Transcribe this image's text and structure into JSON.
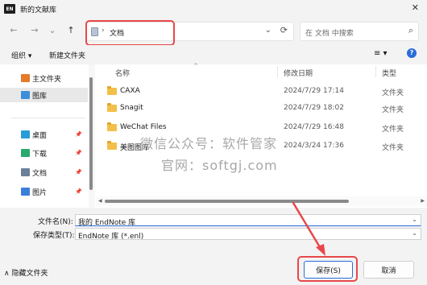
{
  "window": {
    "title": "新的文献库",
    "app_badge": "EN",
    "close_glyph": "✕"
  },
  "nav": {
    "back": "←",
    "forward": "→",
    "recent": "⌄",
    "up": "↑",
    "address_sep": "›",
    "address": "文档",
    "address_dropdown": "⌄",
    "refresh": "⟳",
    "search_placeholder": "在 文档 中搜索",
    "search_icon": "⌕"
  },
  "toolbar": {
    "organize": "组织 ▾",
    "new_folder": "新建文件夹",
    "view_glyph": "≡ ▾",
    "help_glyph": "?"
  },
  "sidebar": {
    "items": [
      {
        "label": "主文件夹",
        "icon": "home-icon",
        "color": "#e57a2a",
        "pinned": false
      },
      {
        "label": "图库",
        "icon": "gallery-icon",
        "color": "#3b8fd9",
        "pinned": false,
        "selected": true
      },
      {
        "label": "桌面",
        "icon": "desktop-icon",
        "color": "#2a9bd9",
        "pinned": true
      },
      {
        "label": "下载",
        "icon": "download-icon",
        "color": "#2aa86e",
        "pinned": true
      },
      {
        "label": "文档",
        "icon": "documents-icon",
        "color": "#6b7f99",
        "pinned": true
      },
      {
        "label": "图片",
        "icon": "pictures-icon",
        "color": "#3b7fd9",
        "pinned": true
      }
    ],
    "pin_glyph": "📌"
  },
  "filelist": {
    "columns": [
      "名称",
      "修改日期",
      "类型"
    ],
    "sort_caret": "^",
    "rows": [
      {
        "name": "CAXA",
        "date": "2024/7/29 17:14",
        "type": "文件夹"
      },
      {
        "name": "Snagit",
        "date": "2024/7/29 18:02",
        "type": "文件夹"
      },
      {
        "name": "WeChat Files",
        "date": "2024/7/29 16:48",
        "type": "文件夹"
      },
      {
        "name": "美图图库",
        "date": "2024/3/24 17:36",
        "type": "文件夹"
      }
    ],
    "scroll_left": "◀",
    "scroll_right": "▶"
  },
  "watermark": {
    "line1": "微信公众号：软件管家",
    "line2": "官网：softgj.com"
  },
  "bottom": {
    "filename_label": "文件名(N):",
    "filename_value": "我的 EndNote 库",
    "filetype_label": "保存类型(T):",
    "filetype_value": "EndNote 库 (*.enl)",
    "dropdown_glyph": "⌄",
    "hide_folders": "∧ 隐藏文件夹",
    "save": "保存(S)",
    "cancel": "取消"
  },
  "colors": {
    "highlight": "#e8474a",
    "accent": "#2a6cdb",
    "folder": "#f2c04a"
  }
}
